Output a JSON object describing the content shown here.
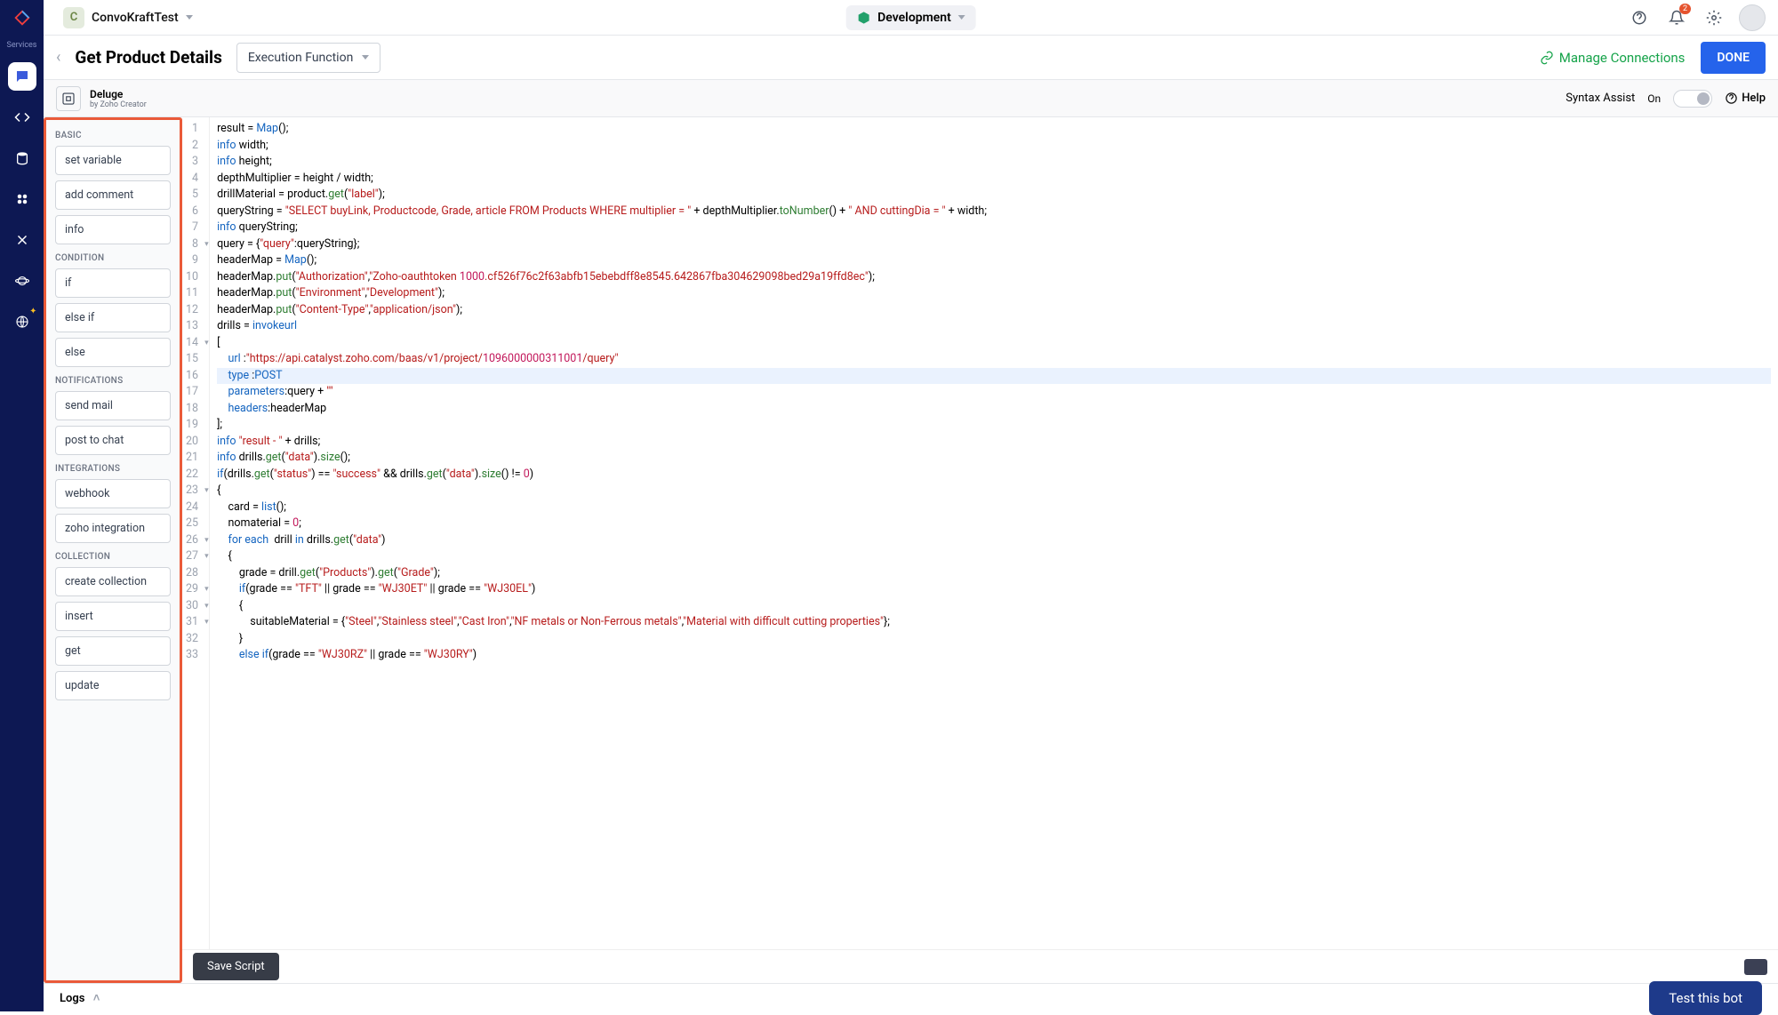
{
  "nav": {
    "services_label": "Services"
  },
  "topbar": {
    "workspace_initial": "C",
    "workspace_name": "ConvoKraftTest",
    "environment_name": "Development",
    "notification_count": "2"
  },
  "titlebar": {
    "page_title": "Get Product Details",
    "select_label": "Execution Function",
    "manage_connections": "Manage Connections",
    "done": "DONE"
  },
  "infobar": {
    "deluge_title": "Deluge",
    "deluge_sub": "by Zoho Creator",
    "syntax_assist_label": "Syntax Assist",
    "syntax_assist_value": "On",
    "help": "Help"
  },
  "snippets": {
    "groups": [
      {
        "title": "BASIC",
        "items": [
          "set variable",
          "add comment",
          "info"
        ]
      },
      {
        "title": "CONDITION",
        "items": [
          "if",
          "else if",
          "else"
        ]
      },
      {
        "title": "NOTIFICATIONS",
        "items": [
          "send mail",
          "post to chat"
        ]
      },
      {
        "title": "INTEGRATIONS",
        "items": [
          "webhook",
          "zoho integration"
        ]
      },
      {
        "title": "COLLECTION",
        "items": [
          "create collection",
          "insert",
          "get",
          "update"
        ]
      }
    ]
  },
  "savebar": {
    "save": "Save Script"
  },
  "logsbar": {
    "logs": "Logs",
    "test": "Test this bot"
  },
  "code": {
    "lines": [
      "result = Map();",
      "info width;",
      "info height;",
      "depthMultiplier = height / width;",
      "drillMaterial = product.get(\"label\");",
      "queryString = \"SELECT buyLink, Productcode, Grade, article FROM Products WHERE multiplier = \" + depthMultiplier.toNumber() + \" AND cuttingDia = \" + width;",
      "info queryString;",
      "query = {\"query\":queryString};",
      "headerMap = Map();",
      "headerMap.put(\"Authorization\",\"Zoho-oauthtoken 1000.cf526f76c2f63abfb15ebebdff8e8545.642867fba304629098bed29a19ffd8ec\");",
      "headerMap.put(\"Environment\",\"Development\");",
      "headerMap.put(\"Content-Type\",\"application/json\");",
      "drills = invokeurl",
      "[",
      "    url :\"https://api.catalyst.zoho.com/baas/v1/project/1096000000311001/query\"",
      "    type :POST",
      "    parameters:query + \"\"",
      "    headers:headerMap",
      "];",
      "info \"result - \" + drills;",
      "info drills.get(\"data\").size();",
      "if(drills.get(\"status\") == \"success\" && drills.get(\"data\").size() != 0)",
      "{",
      "    card = list();",
      "    nomaterial = 0;",
      "    for each  drill in drills.get(\"data\")",
      "    {",
      "        grade = drill.get(\"Products\").get(\"Grade\");",
      "        if(grade == \"TFT\" || grade == \"WJ30ET\" || grade == \"WJ30EL\")",
      "        {",
      "            suitableMaterial = {\"Steel\",\"Stainless steel\",\"Cast Iron\",\"NF metals or Non-Ferrous metals\",\"Material with difficult cutting properties\"};",
      "        }",
      "        else if(grade == \"WJ30RZ\" || grade == \"WJ30RY\")"
    ]
  }
}
